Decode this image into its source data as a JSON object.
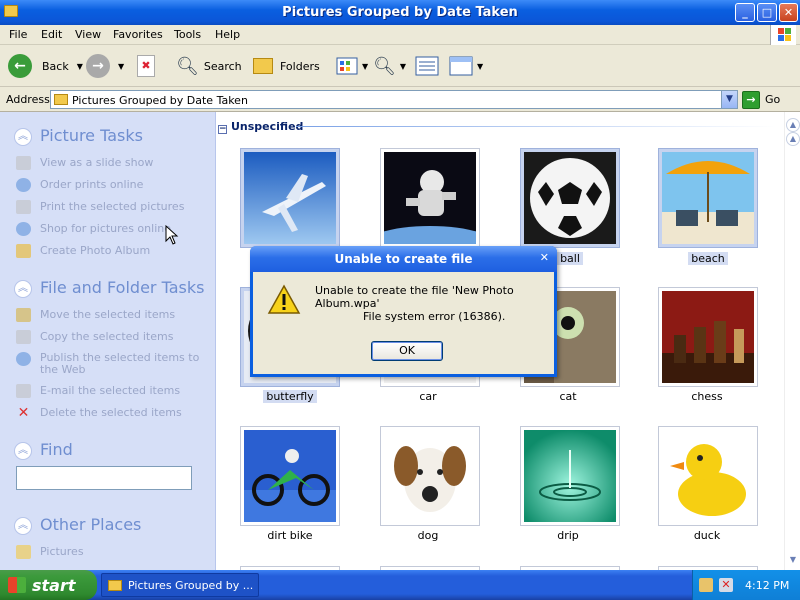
{
  "window": {
    "title": "Pictures Grouped by Date Taken"
  },
  "menu": [
    "File",
    "Edit",
    "View",
    "Favorites",
    "Tools",
    "Help"
  ],
  "toolbar": {
    "back": "Back",
    "search": "Search",
    "folders": "Folders"
  },
  "address": {
    "label": "Address",
    "value": "Pictures Grouped by Date Taken",
    "go": "Go"
  },
  "sidebar": {
    "picture_tasks": {
      "title": "Picture Tasks",
      "items": [
        "View as a slide show",
        "Order prints online",
        "Print the selected pictures",
        "Shop for pictures online",
        "Create Photo Album"
      ]
    },
    "file_tasks": {
      "title": "File and Folder Tasks",
      "items": [
        "Move the selected items",
        "Copy the selected items",
        "Publish the selected items to the Web",
        "E-mail the selected items",
        "Delete the selected items"
      ]
    },
    "find": {
      "title": "Find"
    },
    "other_places": {
      "title": "Other Places",
      "items": [
        "Pictures"
      ]
    }
  },
  "group": {
    "label": "Unspecified"
  },
  "thumbnails": [
    {
      "label": "",
      "selected": true,
      "icon": "airplane"
    },
    {
      "label": "",
      "selected": false,
      "icon": "astronaut"
    },
    {
      "label": "ball",
      "selected": true,
      "icon": "soccer-ball"
    },
    {
      "label": "beach",
      "selected": true,
      "icon": "beach"
    },
    {
      "label": "butterfly",
      "selected": true,
      "icon": "butterfly"
    },
    {
      "label": "car",
      "selected": false,
      "icon": "car"
    },
    {
      "label": "cat",
      "selected": false,
      "icon": "cat"
    },
    {
      "label": "chess",
      "selected": false,
      "icon": "chess"
    },
    {
      "label": "dirt bike",
      "selected": false,
      "icon": "dirt-bike"
    },
    {
      "label": "dog",
      "selected": false,
      "icon": "dog"
    },
    {
      "label": "drip",
      "selected": false,
      "icon": "drip"
    },
    {
      "label": "duck",
      "selected": false,
      "icon": "duck"
    }
  ],
  "dialog": {
    "title": "Unable to create file",
    "message": "Unable to create the file 'New Photo Album.wpa'",
    "error": "File system error (16386).",
    "ok": "OK"
  },
  "taskbar": {
    "start": "start",
    "task": "Pictures Grouped by ...",
    "clock": "4:12 PM"
  }
}
